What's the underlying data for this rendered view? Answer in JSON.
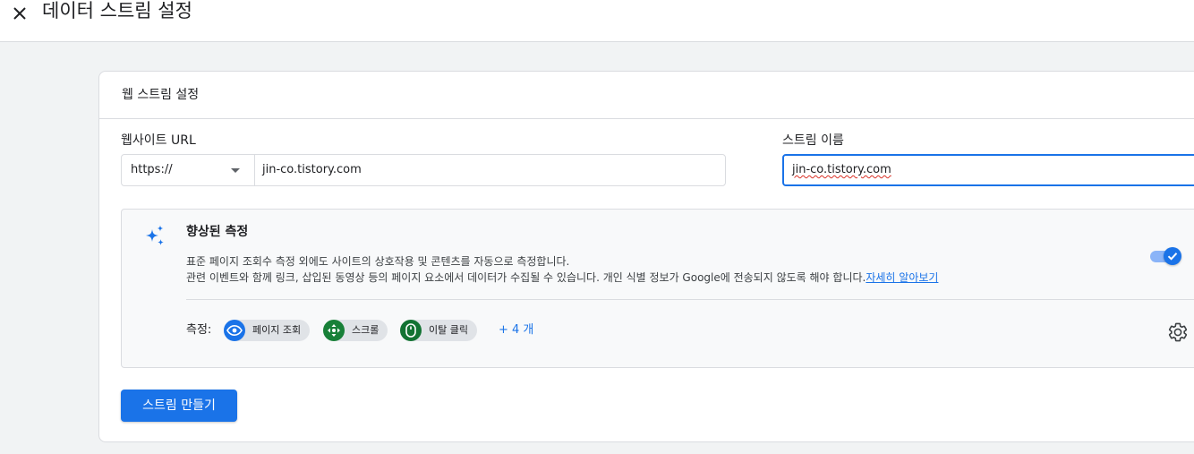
{
  "header": {
    "title": "데이터 스트림 설정",
    "close_icon": "close-icon"
  },
  "card": {
    "title": "웹 스트림 설정",
    "website_url": {
      "label": "웹사이트 URL",
      "protocol": "https://",
      "value": "jin-co.tistory.com"
    },
    "stream_name": {
      "label": "스트림 이름",
      "value": "jin-co.tistory.com"
    },
    "enhanced": {
      "icon": "sparkle-icon",
      "title": "향상된 측정",
      "description_1": "표준 페이지 조회수 측정 외에도 사이트의 상호작용 및 콘텐츠를 자동으로 측정합니다.",
      "description_2": "관련 이벤트와 함께 링크, 삽입된 동영상 등의 페이지 요소에서 데이터가 수집될 수 있습니다. 개인 식별 정보가 Google에 전송되지 않도록 해야 합니다.",
      "learn_more": "자세히 알아보기",
      "toggle_on": true,
      "measure_label": "측정:",
      "chips": [
        {
          "label": "페이지 조회",
          "icon": "eye-icon",
          "color": "#1a73e8"
        },
        {
          "label": "스크롤",
          "icon": "move-icon",
          "color": "#188038"
        },
        {
          "label": "이탈 클릭",
          "icon": "mouse-icon",
          "color": "#137333"
        }
      ],
      "more": "+ 4 개",
      "settings_icon": "gear-icon"
    },
    "create_button": "스트림 만들기"
  },
  "colors": {
    "accent": "#1a73e8",
    "background": "#f1f3f4"
  }
}
